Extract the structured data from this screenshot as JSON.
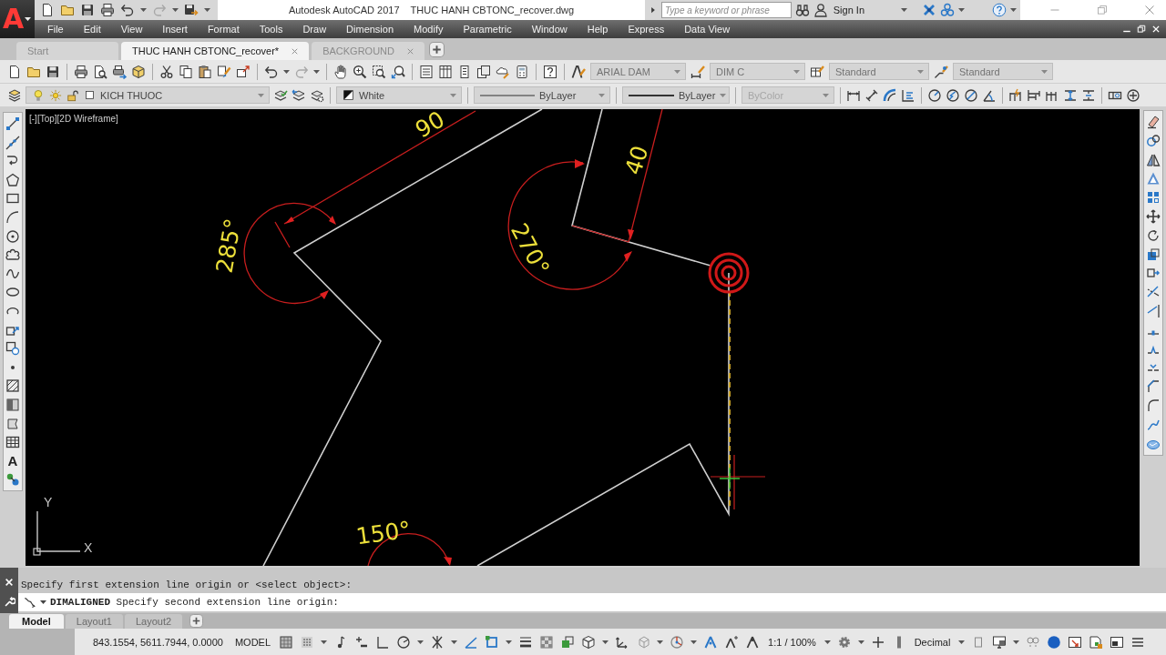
{
  "app_menu": {
    "logo": "A"
  },
  "window": {
    "title": "Autodesk AutoCAD 2017",
    "document": "THUC HANH CBTONC_recover.dwg"
  },
  "search": {
    "placeholder": "Type a keyword or phrase"
  },
  "account": {
    "label": "Sign In"
  },
  "menu_bar": [
    "File",
    "Edit",
    "View",
    "Insert",
    "Format",
    "Tools",
    "Draw",
    "Dimension",
    "Modify",
    "Parametric",
    "Window",
    "Help",
    "Express",
    "Data View"
  ],
  "file_tabs": [
    {
      "label": "Start",
      "selected": false,
      "closable": false
    },
    {
      "label": "THUC HANH CBTONC_recover*",
      "selected": true,
      "closable": true
    },
    {
      "label": "BACKGROUND",
      "selected": false,
      "closable": true
    }
  ],
  "styles_toolbar": [
    {
      "kind": "text",
      "value": "ARIAL DAM"
    },
    {
      "kind": "dimension",
      "value": "DIM C"
    },
    {
      "kind": "table",
      "value": "Standard"
    },
    {
      "kind": "multileader",
      "value": "Standard"
    }
  ],
  "layers_toolbar": {
    "layer": "KICH THUOC"
  },
  "properties_toolbar": [
    {
      "kind": "color",
      "value": "White",
      "disabled": false
    },
    {
      "kind": "linetype",
      "value": "ByLayer",
      "disabled": false
    },
    {
      "kind": "lineweight",
      "value": "ByLayer",
      "disabled": false
    },
    {
      "kind": "plot_style",
      "value": "ByColor",
      "disabled": true
    }
  ],
  "draw_toolbar": {
    "text_tool": "A"
  },
  "viewport": {
    "label": "[-][Top][2D Wireframe]"
  },
  "drawing": {
    "dimension_texts": [
      "90",
      "40",
      "285°",
      "270°",
      "150°"
    ],
    "ucs": {
      "x_axis": "X",
      "y_axis": "Y"
    }
  },
  "command_line": {
    "history": "Specify first extension line origin or <select object>:",
    "prompt": "**DIMALIGNED** Specify second extension line origin:"
  },
  "layout_tabs": [
    {
      "label": "Model",
      "selected": true
    },
    {
      "label": "Layout1",
      "selected": false
    },
    {
      "label": "Layout2",
      "selected": false
    }
  ],
  "status_bar": {
    "coordinates": "843.1554, 5611.7944, 0.0000",
    "space": "MODEL",
    "annotation_scale": "1:1 / 100%",
    "units": "Decimal"
  }
}
